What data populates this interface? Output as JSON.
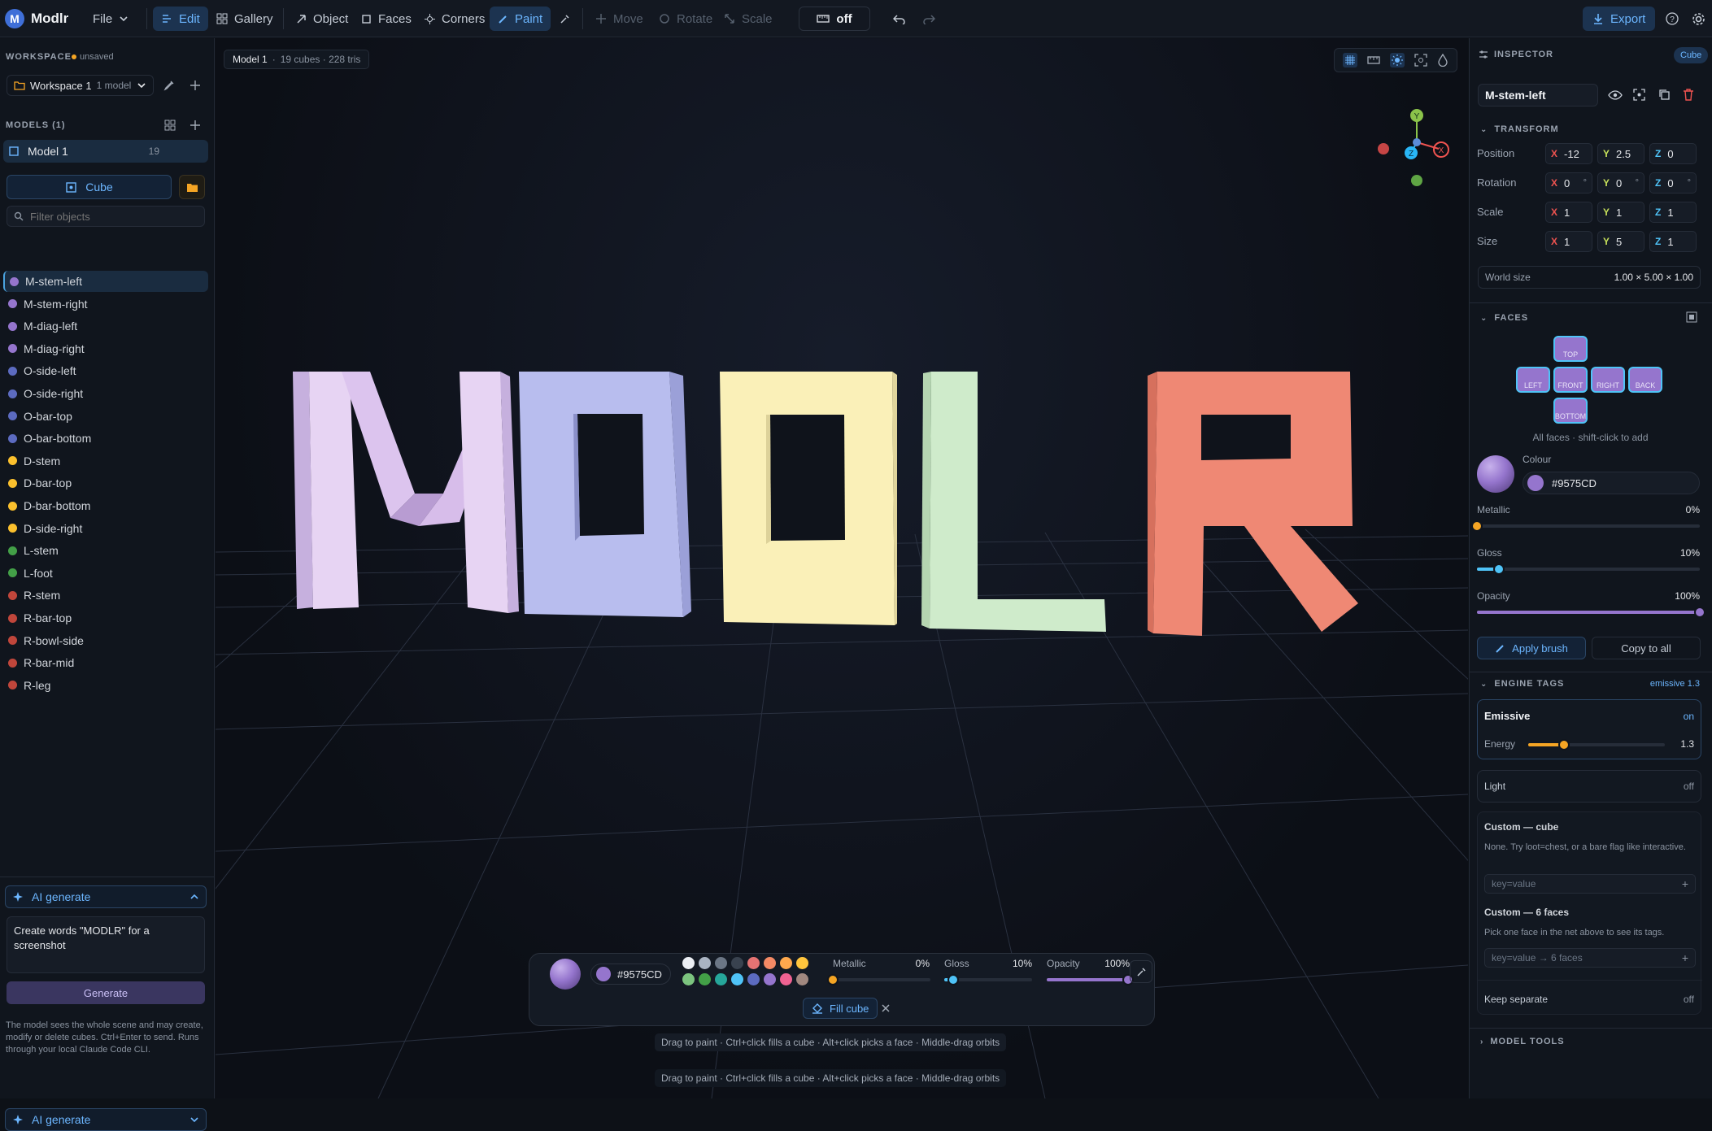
{
  "app": {
    "logo": "M",
    "name": "Modlr",
    "file_menu": "File"
  },
  "toolbar": {
    "edit": "Edit",
    "gallery": "Gallery",
    "object": "Object",
    "faces": "Faces",
    "corners": "Corners",
    "paint": "Paint",
    "move": "Move",
    "rotate": "Rotate",
    "scale": "Scale",
    "snap": "off",
    "export": "Export"
  },
  "workspace": {
    "title": "WORKSPACE",
    "status": "unsaved",
    "name": "Workspace 1",
    "count": "1 model",
    "models_title": "MODELS (1)",
    "model_name": "Model 1",
    "model_count": "19",
    "add_cube": "Cube",
    "filter_placeholder": "Filter objects"
  },
  "objects": [
    {
      "name": "M-stem-left",
      "color": "#9575CD"
    },
    {
      "name": "M-stem-right",
      "color": "#9575CD"
    },
    {
      "name": "M-diag-left",
      "color": "#9575CD"
    },
    {
      "name": "M-diag-right",
      "color": "#9575CD"
    },
    {
      "name": "O-side-left",
      "color": "#5c6bc0"
    },
    {
      "name": "O-side-right",
      "color": "#5c6bc0"
    },
    {
      "name": "O-bar-top",
      "color": "#5c6bc0"
    },
    {
      "name": "O-bar-bottom",
      "color": "#5c6bc0"
    },
    {
      "name": "D-stem",
      "color": "#fbc02d"
    },
    {
      "name": "D-bar-top",
      "color": "#fbc02d"
    },
    {
      "name": "D-bar-bottom",
      "color": "#fbc02d"
    },
    {
      "name": "D-side-right",
      "color": "#fbc02d"
    },
    {
      "name": "L-stem",
      "color": "#43a047"
    },
    {
      "name": "L-foot",
      "color": "#43a047"
    },
    {
      "name": "R-stem",
      "color": "#c0463b"
    },
    {
      "name": "R-bar-top",
      "color": "#c0463b"
    },
    {
      "name": "R-bowl-side",
      "color": "#c0463b"
    },
    {
      "name": "R-bar-mid",
      "color": "#c0463b"
    },
    {
      "name": "R-leg",
      "color": "#c0463b"
    }
  ],
  "ai": {
    "title": "AI generate",
    "prompt": "Create words \"MODLR\" for a screenshot",
    "generate": "Generate",
    "help": "The model sees the whole scene and may create, modify or delete cubes. Ctrl+Enter to send. Runs through your local Claude Code CLI.",
    "title2": "AI generate"
  },
  "viewport": {
    "badge_model": "Model 1",
    "badge_info": "19 cubes · 228 tris",
    "gizmo": {
      "y": "Y",
      "x": "X",
      "z": "Z"
    },
    "hint": "Drag to paint · Ctrl+click fills a cube · Alt+click picks a face · Middle-drag orbits",
    "hint2": "Drag to paint · Ctrl+click fills a cube · Alt+click picks a face · Middle-drag orbits"
  },
  "paintbar": {
    "hex": "#9575CD",
    "metallic_label": "Metallic",
    "metallic_val": "0%",
    "metallic": 0,
    "gloss_label": "Gloss",
    "gloss_val": "10%",
    "gloss": 0.1,
    "opacity_label": "Opacity",
    "opacity_val": "100%",
    "opacity": 1.0,
    "fill": "Fill cube",
    "swatches": [
      "#eceff4",
      "#aab4c3",
      "#6b7685",
      "#39424f",
      "#e57373",
      "#f48a65",
      "#ffa94d",
      "#ffc53d",
      "#7cc47f",
      "#43a047",
      "#26a69a",
      "#4fc3f7",
      "#5c6bc0",
      "#9575cd",
      "#f06292",
      "#a1887f"
    ]
  },
  "inspector": {
    "title": "INSPECTOR",
    "badge": "Cube",
    "object_name": "M-stem-left",
    "transform_title": "TRANSFORM",
    "position_label": "Position",
    "position": {
      "x": "-12",
      "y": "2.5",
      "z": "0"
    },
    "rotation_label": "Rotation",
    "rotation": {
      "x": "0",
      "y": "0",
      "z": "0"
    },
    "scale_label": "Scale",
    "scale": {
      "x": "1",
      "y": "1",
      "z": "1"
    },
    "size_label": "Size",
    "size": {
      "x": "1",
      "y": "5",
      "z": "1"
    },
    "world_label": "World size",
    "world_value": "1.00 × 5.00 × 1.00",
    "faces_title": "FACES",
    "faces": {
      "top": "TOP",
      "left": "LEFT",
      "front": "FRONT",
      "right": "RIGHT",
      "back": "BACK",
      "bottom": "BOTTOM"
    },
    "faces_hint": "All faces · shift-click to add",
    "colour_label": "Colour",
    "colour_hex": "#9575CD",
    "accent": "#9575CD",
    "metallic_label": "Metallic",
    "metallic_val": "0%",
    "metallic": 0,
    "gloss_label": "Gloss",
    "gloss_val": "10%",
    "gloss": 0.1,
    "opacity_label": "Opacity",
    "opacity_val": "100%",
    "opacity": 1.0,
    "apply_brush": "Apply brush",
    "copy_all": "Copy to all",
    "tags_title": "ENGINE TAGS",
    "tags_badge": "emissive 1.3",
    "emissive_label": "Emissive",
    "emissive_state": "on",
    "energy_label": "Energy",
    "energy_val": "1.3",
    "energy": 0.26,
    "light_label": "Light",
    "light_state": "off",
    "custom_cube_title": "Custom — cube",
    "custom_cube_hint": "None. Try loot=chest, or a bare flag like interactive.",
    "custom_cube_placeholder": "key=value",
    "custom_faces_title": "Custom — 6 faces",
    "custom_faces_hint": "Pick one face in the net above to see its tags.",
    "custom_faces_placeholder": "key=value → 6 faces",
    "keep_label": "Keep separate",
    "keep_state": "off",
    "model_tools": "MODEL TOOLS"
  }
}
